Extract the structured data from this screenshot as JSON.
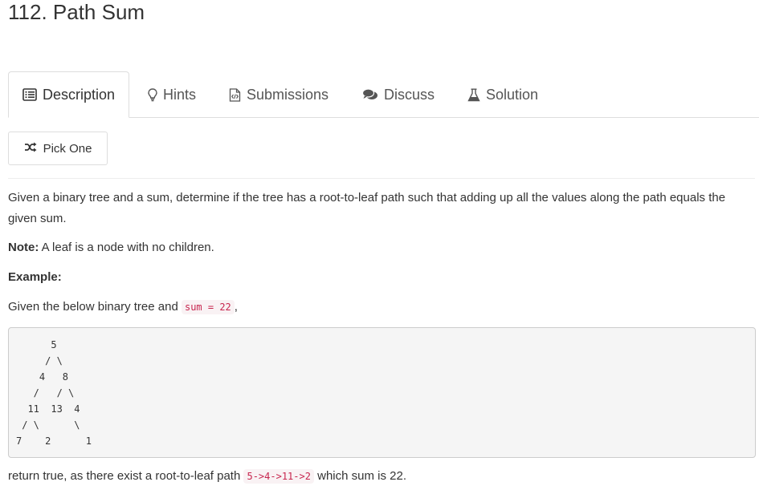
{
  "problem": {
    "title": "112. Path Sum"
  },
  "tabs": [
    {
      "label": "Description",
      "icon": "list-alt-icon",
      "active": true
    },
    {
      "label": "Hints",
      "icon": "lightbulb-icon",
      "active": false
    },
    {
      "label": "Submissions",
      "icon": "code-file-icon",
      "active": false
    },
    {
      "label": "Discuss",
      "icon": "comments-icon",
      "active": false
    },
    {
      "label": "Solution",
      "icon": "flask-icon",
      "active": false
    }
  ],
  "pick_button": {
    "label": "Pick One",
    "icon": "shuffle-icon"
  },
  "description": {
    "paragraph": "Given a binary tree and a sum, determine if the tree has a root-to-leaf path such that adding up all the values along the path equals the given sum.",
    "note_label": "Note:",
    "note_text": " A leaf is a node with no children.",
    "example_label": "Example:",
    "given_prefix": "Given the below binary tree and ",
    "given_code": "sum = 22",
    "given_suffix": ",",
    "tree_text": "      5\n     / \\\n    4   8\n   /   / \\\n  11  13  4\n / \\      \\\n7    2      1",
    "result_prefix": "return true, as there exist a root-to-leaf path ",
    "result_code": "5->4->11->2",
    "result_suffix": " which sum is 22."
  },
  "colors": {
    "code_text": "#c7254e",
    "code_bg": "#f9f2f4",
    "pre_bg": "#f5f5f5",
    "border": "#dddddd"
  }
}
